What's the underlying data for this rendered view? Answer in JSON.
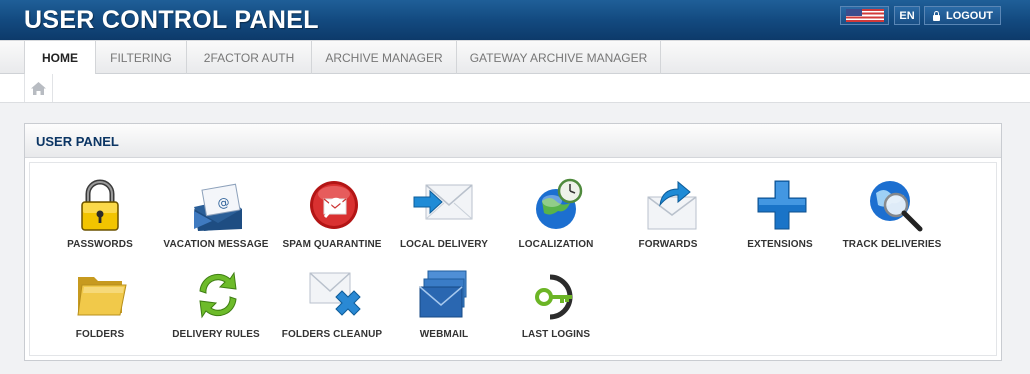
{
  "header": {
    "title": "USER CONTROL PANEL",
    "flag_icon": "us-flag-icon",
    "language_label": "EN",
    "logout_label": "LOGOUT",
    "colors": {
      "header_bg": "#134a80",
      "title_text": "#ffffff"
    }
  },
  "tabs": [
    {
      "label": "HOME",
      "active": true
    },
    {
      "label": "FILTERING"
    },
    {
      "label": "2FACTOR AUTH"
    },
    {
      "label": "ARCHIVE MANAGER"
    },
    {
      "label": "GATEWAY ARCHIVE MANAGER"
    }
  ],
  "breadcrumb": {
    "icon": "home-icon"
  },
  "panel": {
    "title": "USER PANEL",
    "items": [
      {
        "label": "PASSWORDS",
        "icon": "padlock-icon"
      },
      {
        "label": "VACATION MESSAGE",
        "icon": "vacation-mail-icon"
      },
      {
        "label": "SPAM QUARANTINE",
        "icon": "spam-quarantine-icon"
      },
      {
        "label": "LOCAL DELIVERY",
        "icon": "local-delivery-icon"
      },
      {
        "label": "LOCALIZATION",
        "icon": "globe-clock-icon"
      },
      {
        "label": "FORWARDS",
        "icon": "forward-mail-icon"
      },
      {
        "label": "EXTENSIONS",
        "icon": "plus-icon"
      },
      {
        "label": "TRACK DELIVERIES",
        "icon": "globe-magnifier-icon"
      },
      {
        "label": "FOLDERS",
        "icon": "folder-icon"
      },
      {
        "label": "DELIVERY RULES",
        "icon": "recycle-arrows-icon"
      },
      {
        "label": "FOLDERS CLEANUP",
        "icon": "mail-delete-icon"
      },
      {
        "label": "WEBMAIL",
        "icon": "webmail-icon"
      },
      {
        "label": "LAST LOGINS",
        "icon": "key-icon"
      }
    ]
  }
}
